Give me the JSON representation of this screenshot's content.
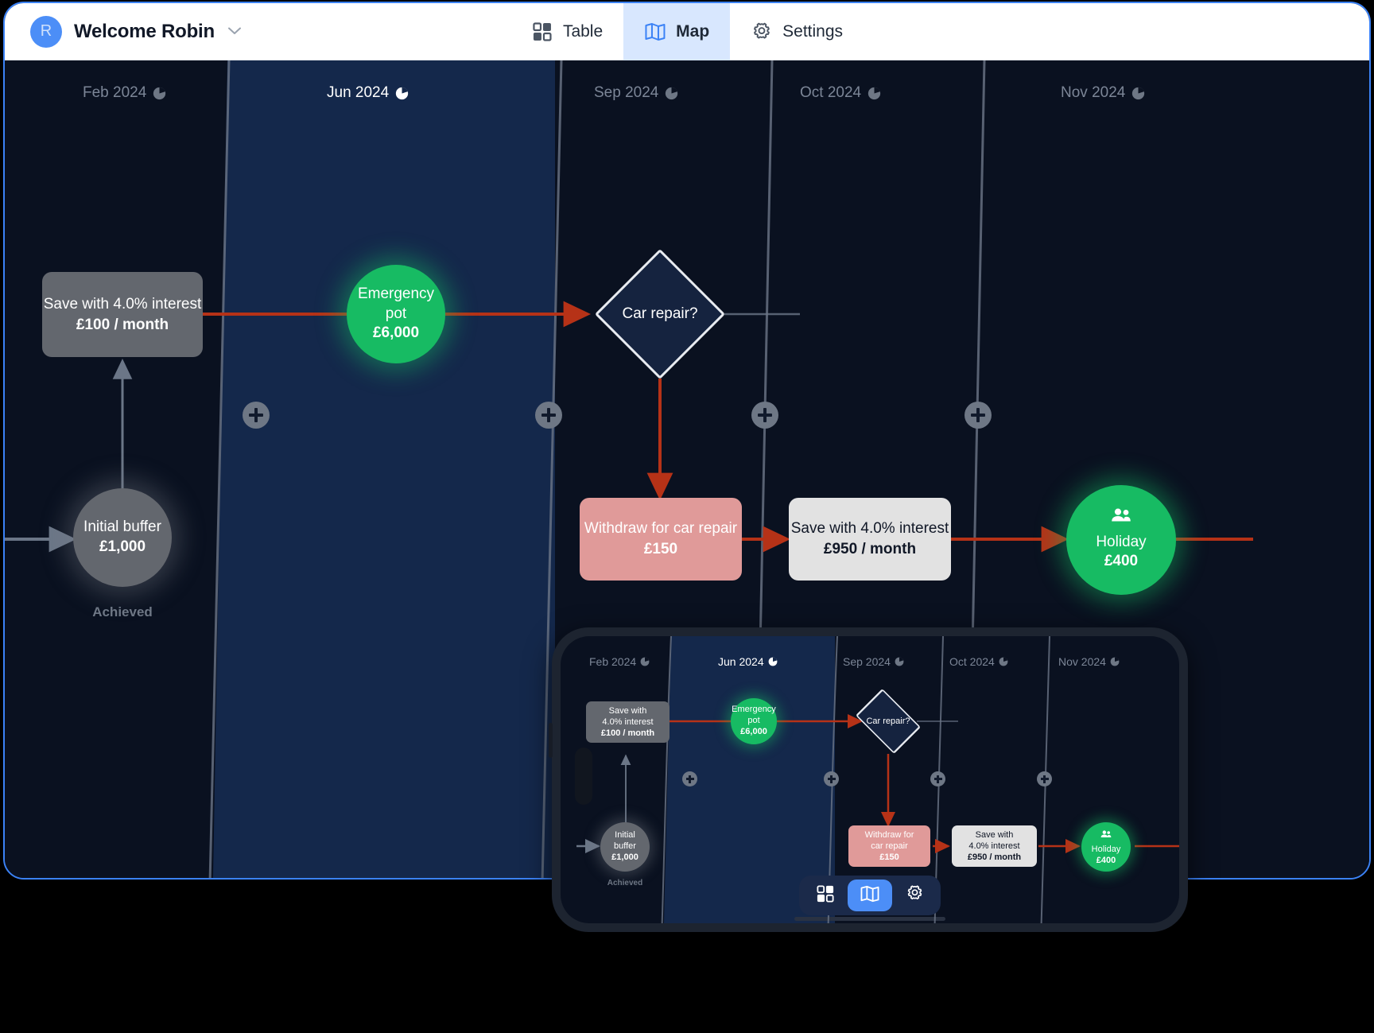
{
  "header": {
    "avatar_initial": "R",
    "welcome_title": "Welcome Robin",
    "chevron": "⌄",
    "tabs": [
      {
        "label": "Table",
        "icon": "grid-icon",
        "active": false
      },
      {
        "label": "Map",
        "icon": "map-icon",
        "active": true
      },
      {
        "label": "Settings",
        "icon": "gear-icon",
        "active": false
      }
    ]
  },
  "timeline": {
    "months": [
      {
        "label": "Feb 2024",
        "icon": "pie-chart-icon",
        "current": false
      },
      {
        "label": "Jun 2024",
        "icon": "pie-chart-icon",
        "current": true
      },
      {
        "label": "Sep 2024",
        "icon": "pie-chart-icon",
        "current": false
      },
      {
        "label": "Oct 2024",
        "icon": "pie-chart-icon",
        "current": false
      },
      {
        "label": "Nov 2024",
        "icon": "pie-chart-icon",
        "current": false
      }
    ],
    "add_buttons": 4,
    "add_button_label": "+"
  },
  "nodes": {
    "save_interest_1": {
      "line1": "Save with 4.0% interest",
      "line2": "£100 / month",
      "shape": "box",
      "color": "#63676e"
    },
    "emergency_pot": {
      "line1": "Emergency pot",
      "line2": "£6,000",
      "shape": "circle",
      "color": "#17bb63"
    },
    "car_repair": {
      "line1": "Car repair?",
      "shape": "diamond",
      "color": "#15233f"
    },
    "withdraw": {
      "line1": "Withdraw for car repair",
      "line2": "£150",
      "shape": "box",
      "color": "#e09a99"
    },
    "save_interest_2": {
      "line1": "Save with 4.0% interest",
      "line2": "£950 / month",
      "shape": "box",
      "color": "#e2e2e2"
    },
    "holiday": {
      "line1": "Holiday",
      "line2": "£400",
      "shape": "circle",
      "color": "#17bb63",
      "icon": "people-icon"
    },
    "initial_buffer": {
      "line1": "Initial buffer",
      "line2": "£1,000",
      "shape": "circle",
      "color": "#63676e",
      "sublabel": "Achieved"
    }
  },
  "phone": {
    "months": [
      {
        "label": "Feb 2024",
        "current": false
      },
      {
        "label": "Jun 2024",
        "current": true
      },
      {
        "label": "Sep 2024",
        "current": false
      },
      {
        "label": "Oct 2024",
        "current": false
      },
      {
        "label": "Nov 2024",
        "current": false
      }
    ],
    "nodes": {
      "save_interest_1": {
        "line1": "Save with",
        "line1b": "4.0% interest",
        "line2": "£100 / month"
      },
      "emergency_pot": {
        "line1": "Emergency",
        "line1b": "pot",
        "line2": "£6,000"
      },
      "car_repair": {
        "line1": "Car repair?"
      },
      "withdraw": {
        "line1": "Withdraw for",
        "line1b": "car repair",
        "line2": "£150"
      },
      "save_interest_2": {
        "line1": "Save with",
        "line1b": "4.0% interest",
        "line2": "£950 / month"
      },
      "holiday": {
        "line1": "Holiday",
        "line2": "£400"
      },
      "initial_buffer": {
        "line1": "Initial",
        "line1b": "buffer",
        "line2": "£1,000",
        "sublabel": "Achieved"
      }
    },
    "tabs": [
      {
        "icon": "grid-icon",
        "active": false
      },
      {
        "icon": "map-icon",
        "active": true
      },
      {
        "icon": "gear-icon",
        "active": false
      }
    ]
  },
  "colors": {
    "accent": "#4c8ef7",
    "green": "#17bb63",
    "grey": "#63676e",
    "salmon": "#e09a99",
    "white_node": "#e2e2e2",
    "edge_red": "#b63217",
    "edge_grey": "#6b7687",
    "canvas": "#0a1120",
    "band": "#14284b"
  }
}
